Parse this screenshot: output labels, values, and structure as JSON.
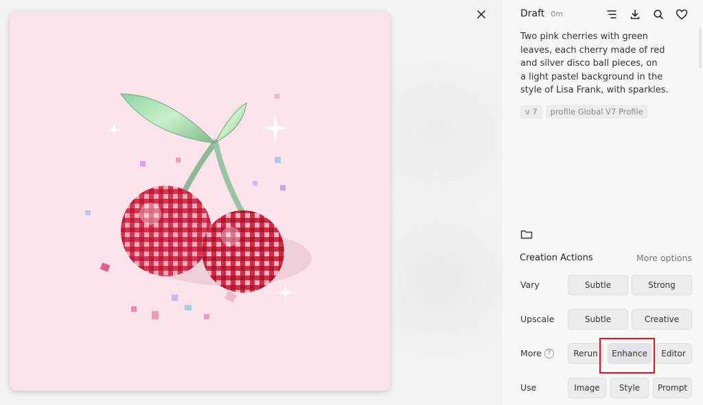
{
  "header": {
    "title": "Draft",
    "time": "0m"
  },
  "prompt": {
    "lines": [
      "Two pink cherries with green",
      "leaves, each cherry made of red",
      "and silver disco ball pieces, on",
      "a light pastel background in the",
      "style of Lisa Frank, with sparkles."
    ]
  },
  "tags": [
    "v 7",
    "profile Global V7 Profile"
  ],
  "creation_actions": {
    "title": "Creation Actions",
    "more_options": "More options",
    "rows": [
      {
        "label": "Vary",
        "buttons": [
          "Subtle",
          "Strong"
        ]
      },
      {
        "label": "Upscale",
        "buttons": [
          "Subtle",
          "Creative"
        ]
      },
      {
        "label": "More",
        "buttons": [
          "Rerun",
          "Enhance",
          "Editor"
        ]
      },
      {
        "label": "Use",
        "buttons": [
          "Image",
          "Style",
          "Prompt"
        ]
      }
    ],
    "help_glyph": "?"
  },
  "icons": [
    "close-icon",
    "filter-lines-icon",
    "download-icon",
    "search-icon",
    "heart-icon",
    "folder-icon",
    "help-icon"
  ],
  "colors": {
    "image_bg": "#fbe4e9",
    "highlight": "#e0141c"
  }
}
